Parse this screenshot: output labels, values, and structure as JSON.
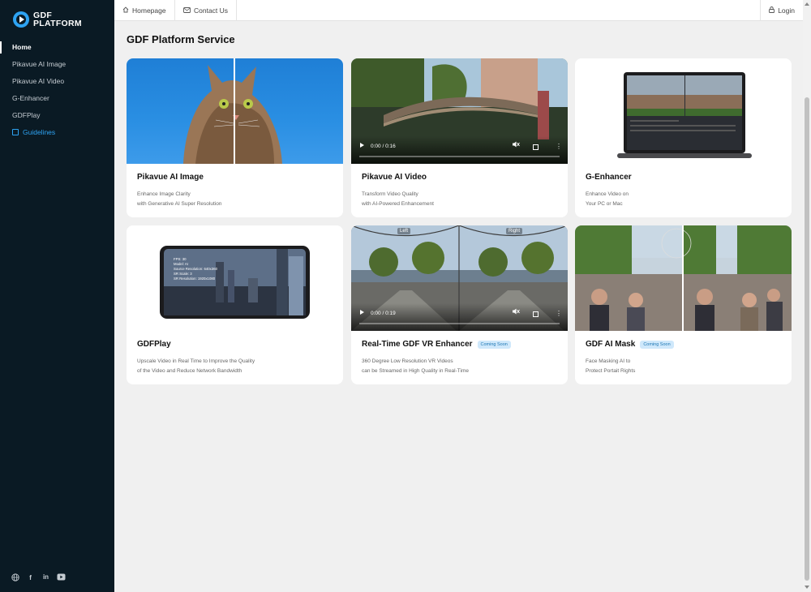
{
  "app": {
    "logo_line1": "GDF",
    "logo_line2": "PLATFORM"
  },
  "sidebar": {
    "items": [
      {
        "label": "Home"
      },
      {
        "label": "Pikavue AI Image"
      },
      {
        "label": "Pikavue AI Video"
      },
      {
        "label": "G-Enhancer"
      },
      {
        "label": "GDFPlay"
      },
      {
        "label": "Guidelines"
      }
    ],
    "social_icons": [
      "globe-icon",
      "facebook-icon",
      "linkedin-icon",
      "youtube-icon"
    ]
  },
  "topbar": {
    "homepage": "Homepage",
    "contact": "Contact Us",
    "login": "Login"
  },
  "main": {
    "title": "GDF Platform Service",
    "cards": [
      {
        "title": "Pikavue AI Image",
        "desc1": "Enhance Image Clarity",
        "desc2": "with Generative AI Super Resolution"
      },
      {
        "title": "Pikavue AI Video",
        "desc1": "Transform Video Quality",
        "desc2": "with AI-Powered Enhancement",
        "time": "0:00 / 0:16",
        "progress": 0
      },
      {
        "title": "G-Enhancer",
        "desc1": "Enhance Video on",
        "desc2": "Your PC or Mac"
      },
      {
        "title": "GDFPlay",
        "desc1": "Upscale Video in Real Time to Improve the Quality",
        "desc2": "of the Video and Reduce Network Bandwidth",
        "phone_overlay": [
          "FPS: 30",
          "Model: AI",
          "Source Resolution: 640x360",
          "SR Scale: 3",
          "SR Resolution: 1920x1080"
        ]
      },
      {
        "title": "Real-Time GDF VR Enhancer",
        "badge": "Coming Soon",
        "desc1": "360 Degree Low Resolution VR Videos",
        "desc2": "can be Streamed in High Quality in Real-Time",
        "time": "0:00 / 0:19",
        "progress": 0,
        "left_label": "Left",
        "right_label": "Right"
      },
      {
        "title": "GDF AI Mask",
        "badge": "Coming Soon",
        "desc1": "Face Masking AI to",
        "desc2": "Protect Portait Rights"
      }
    ]
  },
  "colors": {
    "sidebar_bg": "#0a1a24",
    "accent": "#2ea3f2",
    "badge_bg": "#cfe8fb",
    "badge_text": "#1f78b4"
  }
}
